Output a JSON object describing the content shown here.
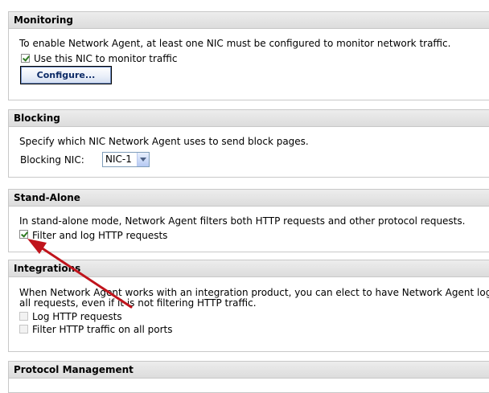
{
  "monitoring": {
    "title": "Monitoring",
    "description": "To enable Network Agent, at least one NIC must be configured to monitor network traffic.",
    "use_nic_label": "Use this NIC to monitor traffic",
    "use_nic_checked": true,
    "configure_label": "Configure..."
  },
  "blocking": {
    "title": "Blocking",
    "description": "Specify which NIC Network Agent uses to send block pages.",
    "nic_label": "Blocking NIC:",
    "nic_value": "NIC-1"
  },
  "standalone": {
    "title": "Stand-Alone",
    "description": "In stand-alone mode, Network Agent filters both HTTP requests and other protocol requests.",
    "filter_log_label": "Filter and log HTTP requests",
    "filter_log_checked": true
  },
  "integrations": {
    "title": "Integrations",
    "description_line1": "When Network Agent works with an integration product, you can elect to have Network Agent log",
    "description_line2": "all requests, even if it is not filtering HTTP traffic.",
    "log_http_label": "Log HTTP requests",
    "log_http_checked": false,
    "filter_all_ports_label": "Filter HTTP traffic on all ports",
    "filter_all_ports_checked": false
  },
  "protocol": {
    "title": "Protocol Management"
  },
  "colors": {
    "annotation_arrow": "#c0141c",
    "header_bg": "#e4e4e4",
    "border": "#c8c8c8",
    "button_text": "#0c2a66"
  }
}
